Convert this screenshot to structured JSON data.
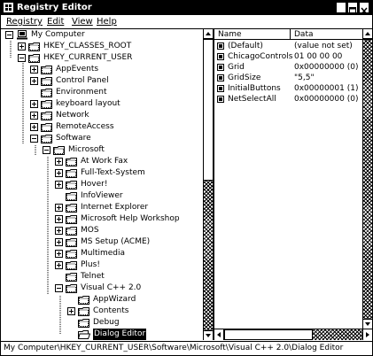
{
  "window": {
    "title": "Registry Editor"
  },
  "menu": [
    {
      "label": "Registry"
    },
    {
      "label": "Edit"
    },
    {
      "label": "View"
    },
    {
      "label": "Help"
    }
  ],
  "tree": [
    {
      "label": "My Computer",
      "level": 0,
      "expander": "-",
      "icon": "computer-icon"
    },
    {
      "label": "HKEY_CLASSES_ROOT",
      "level": 1,
      "expander": "+",
      "icon": "folder-icon"
    },
    {
      "label": "HKEY_CURRENT_USER",
      "level": 1,
      "expander": "-",
      "icon": "folder-icon"
    },
    {
      "label": "AppEvents",
      "level": 2,
      "expander": "+",
      "icon": "folder-icon"
    },
    {
      "label": "Control Panel",
      "level": 2,
      "expander": "+",
      "icon": "folder-icon"
    },
    {
      "label": "Environment",
      "level": 2,
      "expander": "",
      "icon": "folder-icon"
    },
    {
      "label": "keyboard layout",
      "level": 2,
      "expander": "+",
      "icon": "folder-icon"
    },
    {
      "label": "Network",
      "level": 2,
      "expander": "+",
      "icon": "folder-icon"
    },
    {
      "label": "RemoteAccess",
      "level": 2,
      "expander": "+",
      "icon": "folder-icon"
    },
    {
      "label": "Software",
      "level": 2,
      "expander": "-",
      "icon": "folder-icon"
    },
    {
      "label": "Microsoft",
      "level": 3,
      "expander": "-",
      "icon": "folder-icon"
    },
    {
      "label": "At Work Fax",
      "level": 4,
      "expander": "+",
      "icon": "folder-icon"
    },
    {
      "label": "Full-Text-System",
      "level": 4,
      "expander": "+",
      "icon": "folder-icon"
    },
    {
      "label": "Hover!",
      "level": 4,
      "expander": "+",
      "icon": "folder-icon"
    },
    {
      "label": "InfoViewer",
      "level": 4,
      "expander": "",
      "icon": "folder-icon"
    },
    {
      "label": "Internet Explorer",
      "level": 4,
      "expander": "+",
      "icon": "folder-icon"
    },
    {
      "label": "Microsoft Help Workshop",
      "level": 4,
      "expander": "+",
      "icon": "folder-icon"
    },
    {
      "label": "MOS",
      "level": 4,
      "expander": "+",
      "icon": "folder-icon"
    },
    {
      "label": "MS Setup (ACME)",
      "level": 4,
      "expander": "+",
      "icon": "folder-icon"
    },
    {
      "label": "Multimedia",
      "level": 4,
      "expander": "+",
      "icon": "folder-icon"
    },
    {
      "label": "Plus!",
      "level": 4,
      "expander": "+",
      "icon": "folder-icon"
    },
    {
      "label": "Telnet",
      "level": 4,
      "expander": "",
      "icon": "folder-icon"
    },
    {
      "label": "Visual C++ 2.0",
      "level": 4,
      "expander": "-",
      "icon": "folder-icon"
    },
    {
      "label": "AppWizard",
      "level": 5,
      "expander": "",
      "icon": "folder-icon"
    },
    {
      "label": "Contents",
      "level": 5,
      "expander": "+",
      "icon": "folder-icon"
    },
    {
      "label": "Debug",
      "level": 5,
      "expander": "",
      "icon": "folder-icon"
    },
    {
      "label": "Dialog Editor",
      "level": 5,
      "expander": "",
      "icon": "folder-open-icon",
      "selected": true
    }
  ],
  "values": {
    "headers": {
      "name": "Name",
      "data": "Data"
    },
    "rows": [
      {
        "name": "(Default)",
        "data": "(value not set)"
      },
      {
        "name": "ChicagoControls",
        "data": "01 00 00 00"
      },
      {
        "name": "Grid",
        "data": "0x00000000 (0)"
      },
      {
        "name": "GridSize",
        "data": "\"5,5\""
      },
      {
        "name": "InitialButtons",
        "data": "0x00000001 (1)"
      },
      {
        "name": "NetSelectAll",
        "data": "0x00000000 (0)"
      }
    ]
  },
  "status": {
    "text": "My Computer\\HKEY_CURRENT_USER\\Software\\Microsoft\\Visual C++ 2.0\\Dialog Editor"
  }
}
